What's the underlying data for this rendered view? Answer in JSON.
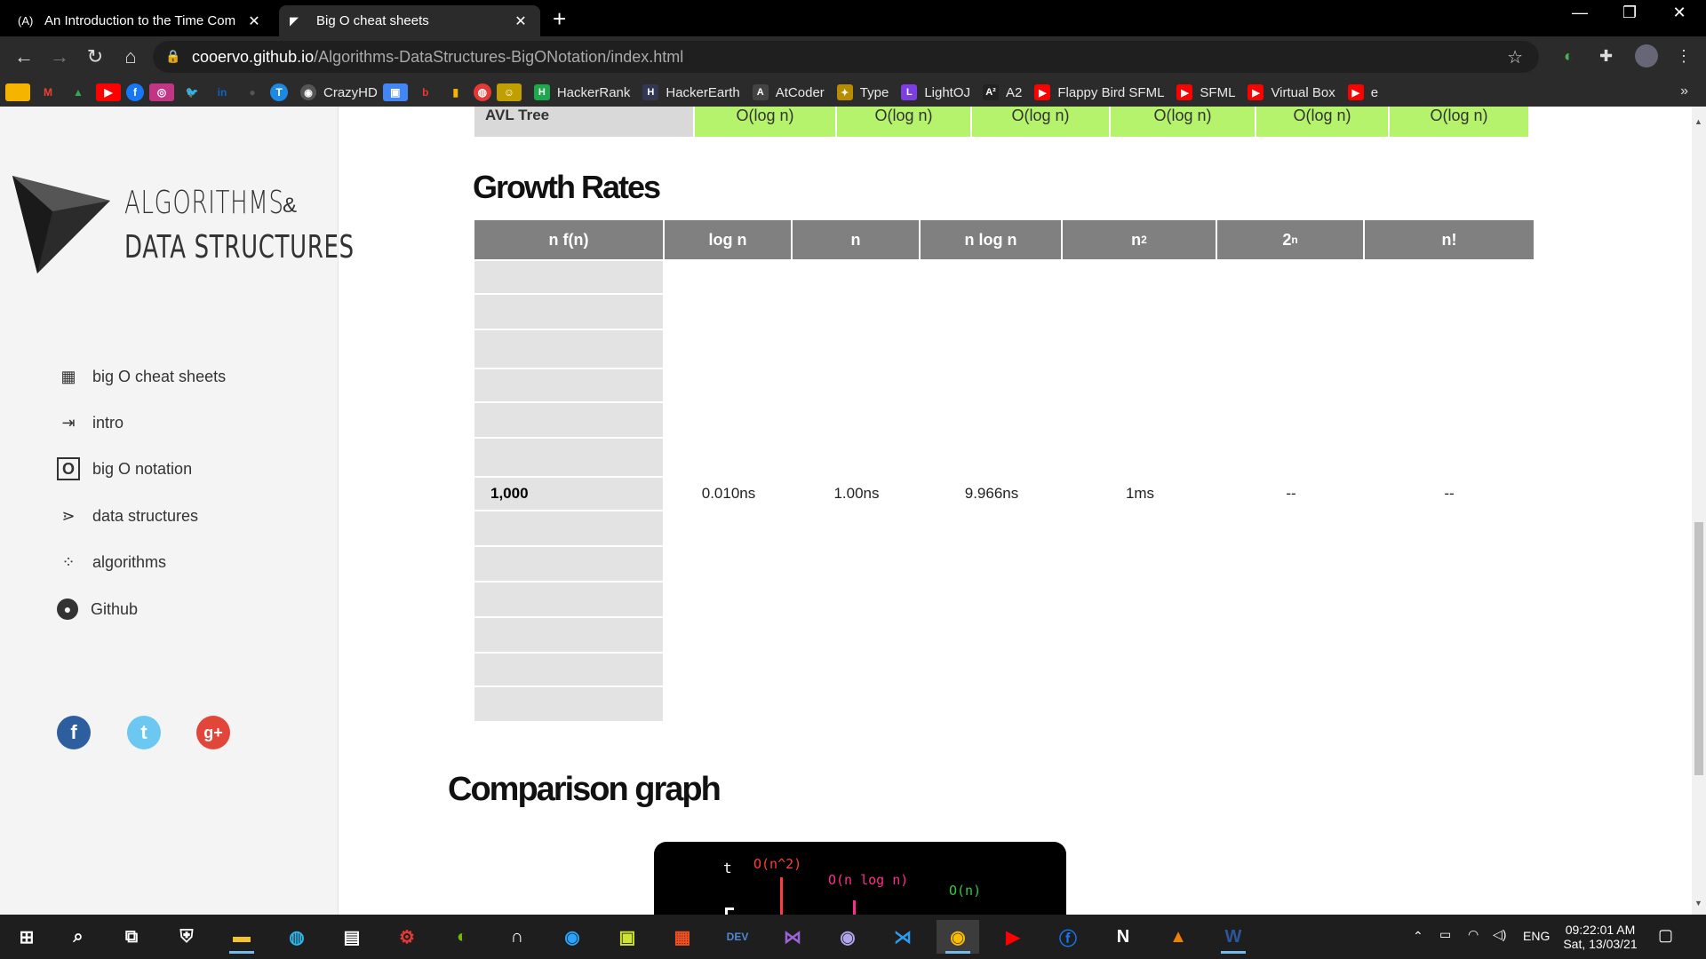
{
  "browser": {
    "tabs": [
      {
        "favicon": "(A)",
        "title": "An Introduction to the Time Com"
      },
      {
        "title": "Big O cheat sheets"
      }
    ],
    "new_tab_label": "+",
    "window_controls": {
      "minimize": "—",
      "restore": "❐",
      "close": "✕"
    },
    "url": {
      "host": "cooervo.github.io",
      "path": "/Algorithms-DataStructures-BigONotation/index.html"
    },
    "bookmarks": [
      {
        "label": "CrazyHD",
        "color": "#555555"
      },
      {
        "label": "HackerRank",
        "color": "#1ba94c"
      },
      {
        "label": "HackerEarth",
        "color": "#323754"
      },
      {
        "label": "AtCoder",
        "color": "#555555"
      },
      {
        "label": "Type",
        "color": "#b88b00"
      },
      {
        "label": "LightOJ",
        "color": "#7b3fe4"
      },
      {
        "label": "A2",
        "color": "#222222"
      },
      {
        "label": "Flappy Bird SFML",
        "color": "#ff0000"
      },
      {
        "label": "SFML",
        "color": "#ff0000"
      },
      {
        "label": "Virtual Box",
        "color": "#ff0000"
      },
      {
        "label": "e",
        "color": "#ff0000"
      }
    ],
    "more": "»"
  },
  "sidebar": {
    "logo_line1": "ALGORITHMS",
    "logo_amp": "&",
    "logo_line2": "DATA STRUCTURES",
    "nav": [
      {
        "label": "big O cheat sheets",
        "icon": "grid-icon"
      },
      {
        "label": "intro",
        "icon": "enter-icon"
      },
      {
        "label": "big O notation",
        "icon": "o-box-icon"
      },
      {
        "label": "data structures",
        "icon": "graph-icon"
      },
      {
        "label": "algorithms",
        "icon": "dots-icon"
      },
      {
        "label": "Github",
        "icon": "github-icon"
      }
    ],
    "social": [
      {
        "name": "facebook",
        "glyph": "f",
        "color": "#2d5e9e"
      },
      {
        "name": "twitter",
        "glyph": "t",
        "color": "#6cc7f1"
      },
      {
        "name": "google-plus",
        "glyph": "g+",
        "color": "#e2463b"
      }
    ]
  },
  "main": {
    "avl_row": {
      "label": "AVL Tree",
      "values": [
        "O(log n)",
        "O(log n)",
        "O(log n)",
        "O(log n)",
        "O(log n)",
        "O(log n)"
      ]
    },
    "growth_title": "Growth Rates",
    "growth_headers": [
      "n f(n)",
      "log n",
      "n",
      "n log n",
      "n2",
      "2n",
      "n!"
    ],
    "growth_row": {
      "n": "1,000",
      "log_n": "0.010ns",
      "n_val": "1.00ns",
      "n_log_n": "9.966ns",
      "n2": "1ms",
      "two_n": "--",
      "n_fact": "--"
    },
    "comparison_title": "Comparison graph",
    "graph_labels": {
      "t": "t",
      "n2": "O(n^2)",
      "nlogn": "O(n log n)",
      "n": "O(n)"
    }
  },
  "taskbar": {
    "tray_lang": "ENG",
    "time": "09:22:01 AM",
    "date": "Sat, 13/03/21"
  }
}
